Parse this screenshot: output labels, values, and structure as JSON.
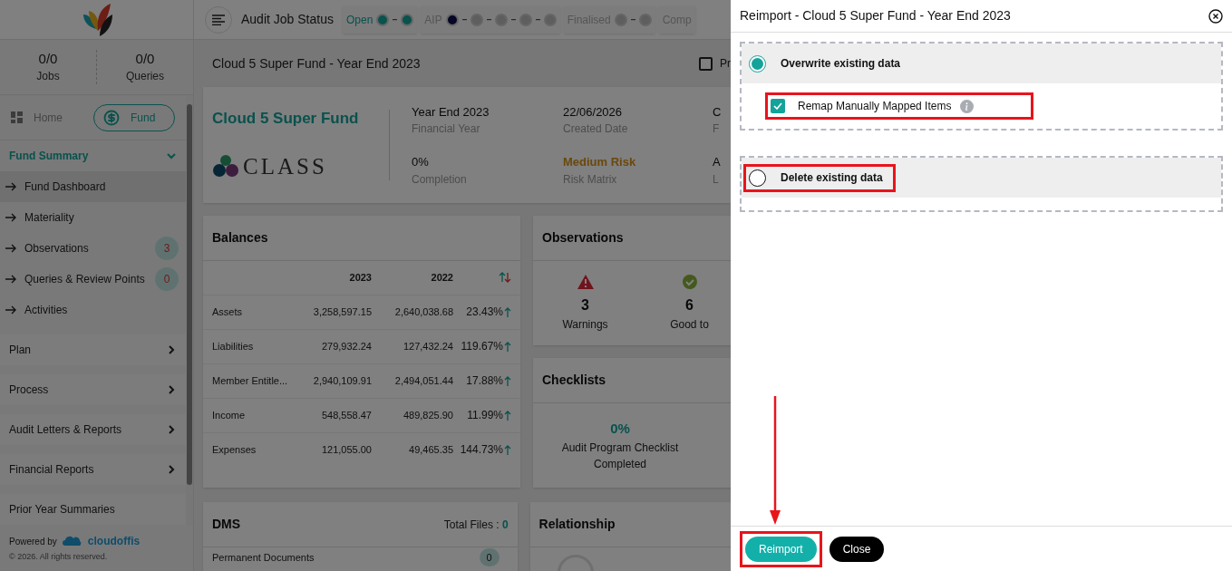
{
  "sidebar": {
    "stats": [
      {
        "value": "0/0",
        "label": "Jobs"
      },
      {
        "value": "0/0",
        "label": "Queries"
      }
    ],
    "toggle": [
      {
        "label": "Home",
        "kind": "home",
        "selected": false
      },
      {
        "label": "Fund",
        "kind": "fund",
        "selected": true
      }
    ],
    "section": {
      "title": "Fund Summary",
      "expanded": true,
      "items": [
        {
          "label": "Fund Dashboard",
          "selected": true
        },
        {
          "label": "Materiality",
          "selected": false
        },
        {
          "label": "Observations",
          "selected": false,
          "count": "3"
        },
        {
          "label": "Queries & Review Points",
          "selected": false,
          "count": "0"
        },
        {
          "label": "Activities",
          "selected": false
        }
      ]
    },
    "groups": [
      {
        "label": "Plan",
        "kind": "collapsible"
      },
      {
        "label": "Process",
        "kind": "collapsible"
      },
      {
        "label": "Audit Letters & Reports",
        "kind": "collapsible"
      },
      {
        "label": "Financial Reports",
        "kind": "collapsible"
      },
      {
        "label": "Prior Year Summaries",
        "kind": "link"
      }
    ],
    "footer": {
      "powered_by": "Powered by",
      "brand": "cloudoffis",
      "copyright": "© 2026. All rights reserved."
    }
  },
  "top_bar": {
    "title": "Audit Job Status",
    "stages": [
      {
        "label": "Open",
        "selected": true,
        "steps": [
          {
            "kind": "done"
          },
          {
            "kind": "done"
          }
        ]
      },
      {
        "label": "AIP",
        "selected": false,
        "steps": [
          {
            "kind": "current"
          },
          {
            "kind": "pending"
          },
          {
            "kind": "pending"
          },
          {
            "kind": "pending"
          },
          {
            "kind": "pending"
          }
        ]
      },
      {
        "label": "Finalised",
        "selected": false,
        "steps": [
          {
            "kind": "pending"
          },
          {
            "kind": "pending"
          }
        ]
      },
      {
        "label": "Comp",
        "selected": false
      }
    ]
  },
  "page": {
    "title": "Cloud 5 Super Fund - Year End 2023",
    "checkbox": {
      "label": "Pr",
      "checked": false
    }
  },
  "fund_card": {
    "name": "Cloud 5 Super Fund",
    "logo_text": "CLASS",
    "fields": [
      {
        "value": "Year End 2023",
        "label": "Financial Year",
        "kind": "plain"
      },
      {
        "value": "22/06/2026",
        "label": "Created Date",
        "kind": "plain"
      },
      {
        "value": "C",
        "label": "F",
        "kind": "plain"
      },
      {
        "value": "0%",
        "label": "Completion",
        "kind": "plain"
      },
      {
        "value": "Medium Risk",
        "label": "Risk Matrix",
        "kind": "risk"
      },
      {
        "value": "A",
        "label": "L",
        "kind": "plain"
      }
    ]
  },
  "balances": {
    "title": "Balances",
    "columns": [
      "2023",
      "2022"
    ],
    "rows": [
      {
        "name": "Assets",
        "current": "3,258,597.15",
        "previous": "2,640,038.68",
        "change": "23.43%",
        "kind": "up"
      },
      {
        "name": "Liabilities",
        "current": "279,932.24",
        "previous": "127,432.24",
        "change": "119.67%",
        "kind": "up"
      },
      {
        "name": "Member Entitle...",
        "current": "2,940,109.91",
        "previous": "2,494,051.44",
        "change": "17.88%",
        "kind": "up"
      },
      {
        "name": "Income",
        "current": "548,558.47",
        "previous": "489,825.90",
        "change": "11.99%",
        "kind": "up"
      },
      {
        "name": "Expenses",
        "current": "121,055.00",
        "previous": "49,465.35",
        "change": "144.73%",
        "kind": "up"
      }
    ]
  },
  "observations": {
    "title": "Observations",
    "stats": [
      {
        "value": "3",
        "label": "Warnings",
        "kind": "warning"
      },
      {
        "value": "6",
        "label": "Good to",
        "kind": "good"
      }
    ]
  },
  "checklists": {
    "title": "Checklists",
    "percent": "0%",
    "caption": "Audit Program Checklist Completed"
  },
  "dms": {
    "title": "DMS",
    "total_label": "Total Files :",
    "total": "0",
    "items": [
      {
        "label": "Permanent Documents",
        "count": "0"
      }
    ]
  },
  "relationship": {
    "title": "Relationship"
  },
  "dialog": {
    "title": "Reimport - Cloud 5 Super Fund - Year End 2023",
    "options": [
      {
        "label": "Overwrite existing data",
        "selected": true,
        "highlighted": false,
        "sub_options": [
          {
            "label": "Remap Manually Mapped Items",
            "checked": true,
            "highlighted": true
          }
        ]
      },
      {
        "label": "Delete existing data",
        "selected": false,
        "highlighted": true
      }
    ],
    "buttons": [
      {
        "label": "Reimport",
        "kind": "primary",
        "highlighted": true
      },
      {
        "label": "Close",
        "kind": "secondary",
        "highlighted": false
      }
    ],
    "annotation_arrow": true
  }
}
